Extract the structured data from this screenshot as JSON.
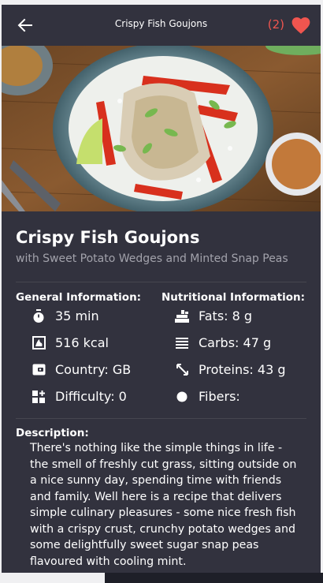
{
  "appbar": {
    "title": "Crispy Fish Goujons",
    "favorites_count": "(2)"
  },
  "recipe": {
    "name": "Crispy Fish Goujons",
    "subtitle": "with Sweet Potato Wedges and Minted Snap Peas"
  },
  "general": {
    "heading": "General Information:",
    "time": "35 min",
    "calories": "516 kcal",
    "country": "Country: GB",
    "difficulty": "Difficulty: 0"
  },
  "nutrition": {
    "heading": "Nutritional Information:",
    "fats": "Fats: 8 g",
    "carbs": "Carbs: 47 g",
    "proteins": "Proteins: 43 g",
    "fibers": "Fibers:"
  },
  "description": {
    "heading": "Description:",
    "text": "There's nothing like the simple things in life - the smell of freshly cut grass, sitting outside on a nice sunny day, spending time with friends and family. Well here is a recipe that delivers simple culinary pleasures - some nice fresh fish with a crispy crust, crunchy potato wedges and some delightfully sweet sugar snap peas flavoured with cooling mint."
  },
  "colors": {
    "background": "#32323e",
    "accent": "#f0554f",
    "text": "#ffffff",
    "subtext": "#a2a2ab"
  },
  "icons": [
    "arrow-left-icon",
    "heart-icon",
    "timer-icon",
    "calories-icon",
    "wallet-icon",
    "difficulty-icon",
    "fats-icon",
    "carbs-icon",
    "proteins-icon",
    "fibers-icon"
  ]
}
